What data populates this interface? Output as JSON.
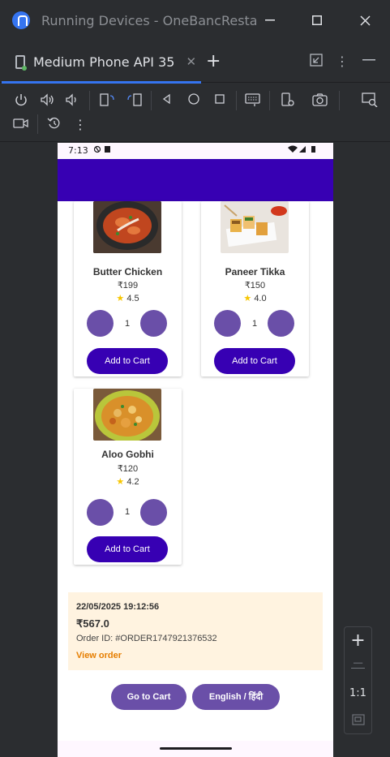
{
  "window": {
    "title": "Running Devices - OneBancResta",
    "minimize_icon": "minimize-icon",
    "maximize_icon": "maximize-icon",
    "close_icon": "close-icon"
  },
  "tabs": [
    {
      "label": "Medium Phone API 35",
      "icon": "phone-icon",
      "active": true
    }
  ],
  "toolbar": {
    "icons": [
      "power-icon",
      "volume-up-icon",
      "volume-down-icon",
      "rotate-left-icon",
      "rotate-right-icon",
      "back-icon",
      "home-icon",
      "overview-icon",
      "keyboard-icon",
      "device-settings-icon",
      "camera-icon",
      "zoom-inspect-icon",
      "record-icon",
      "reset-icon",
      "more-icon"
    ]
  },
  "device": {
    "status": {
      "time": "7:13"
    },
    "colors": {
      "appbar": "#3700b3",
      "primary_button": "#3700b3",
      "qty_button": "#6a4fa8",
      "order_bg": "#fff3e0",
      "link": "#e67e00"
    },
    "items": [
      {
        "name": "Butter Chicken",
        "price": "₹199",
        "rating": "4.5",
        "qty": "1",
        "add_label": "Add to Cart"
      },
      {
        "name": "Paneer Tikka",
        "price": "₹150",
        "rating": "4.0",
        "qty": "1",
        "add_label": "Add to Cart"
      },
      {
        "name": "Aloo Gobhi",
        "price": "₹120",
        "rating": "4.2",
        "qty": "1",
        "add_label": "Add to Cart"
      }
    ],
    "order": {
      "date": "22/05/2025 19:12:56",
      "amount": "₹567.0",
      "order_id": "Order ID: #ORDER1747921376532",
      "link": "View order"
    },
    "buttons": {
      "cart": "Go to Cart",
      "language": "English / हिंदी"
    }
  },
  "zoom": {
    "plus": "+",
    "minus": "−",
    "ratio": "1:1"
  }
}
